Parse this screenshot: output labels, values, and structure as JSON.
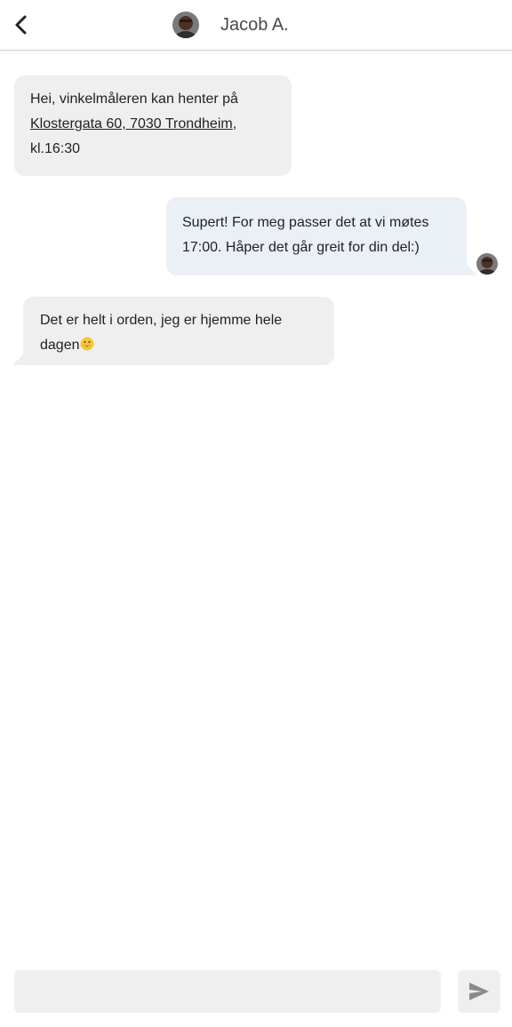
{
  "header": {
    "contact_name": "Jacob A."
  },
  "messages": [
    {
      "direction": "incoming",
      "text_before": "Hei, vinkelmåleren kan henter på ",
      "address_link": "Klostergata 60, 7030 Trondheim",
      "text_after": ", kl.16:30"
    },
    {
      "direction": "outgoing",
      "text": "Supert! For meg passer det at vi møtes 17:00. Håper det går greit for din del:)"
    },
    {
      "direction": "incoming",
      "text": "Det er helt i orden, jeg er hjemme hele dagen",
      "emoji": "grinning-face-emoji"
    }
  ],
  "composer": {
    "placeholder": "",
    "value": ""
  },
  "icons": {
    "back": "chevron-left-icon",
    "send": "send-icon"
  },
  "colors": {
    "incoming_bubble": "#efefef",
    "outgoing_bubble": "#eaf0f6",
    "input_bg": "#efefef",
    "send_icon": "#8a8a8a"
  }
}
